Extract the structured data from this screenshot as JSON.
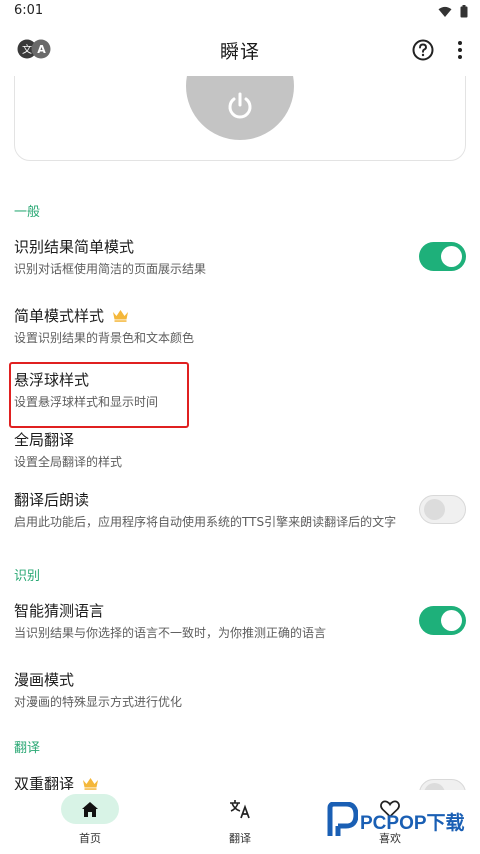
{
  "status_bar": {
    "time": "6:01"
  },
  "app_bar": {
    "logo_text": "文A",
    "title": "瞬译",
    "help_icon": "help-circle-icon",
    "more_icon": "more-vert-icon"
  },
  "service_card": {
    "icon": "power-icon"
  },
  "sections": {
    "general": "一般",
    "recognition": "识别",
    "translation": "翻译"
  },
  "settings": [
    {
      "title": "识别结果简单模式",
      "desc": "识别对话框使用简洁的页面展示结果",
      "toggle": true
    },
    {
      "title": "简单模式样式",
      "desc": "设置识别结果的背景色和文本颜色",
      "premium": true
    },
    {
      "title": "悬浮球样式",
      "desc": "设置悬浮球样式和显示时间"
    },
    {
      "title": "全局翻译",
      "desc": "设置全局翻译的样式"
    },
    {
      "title": "翻译后朗读",
      "desc": "启用此功能后，应用程序将自动使用系统的TTS引擎来朗读翻译后的文字",
      "toggle": false
    },
    {
      "title": "智能猜测语言",
      "desc": "当识别结果与你选择的语言不一致时，为你推测正确的语言",
      "toggle": true
    },
    {
      "title": "漫画模式",
      "desc": "对漫画的特殊显示方式进行优化"
    },
    {
      "title": "双重翻译",
      "premium": true,
      "toggle": false
    }
  ],
  "bottom_nav": [
    {
      "label": "首页",
      "icon": "home-icon",
      "active": true
    },
    {
      "label": "翻译",
      "icon": "translate-icon",
      "active": false
    },
    {
      "label": "喜欢",
      "icon": "heart-icon",
      "active": false
    }
  ],
  "watermark": {
    "text": "PCPOP下载"
  },
  "colors": {
    "accent": "#1eb07a",
    "section_header": "#2aa874",
    "highlight": "#e02020",
    "nav_active_bg": "#d8f3e6"
  }
}
